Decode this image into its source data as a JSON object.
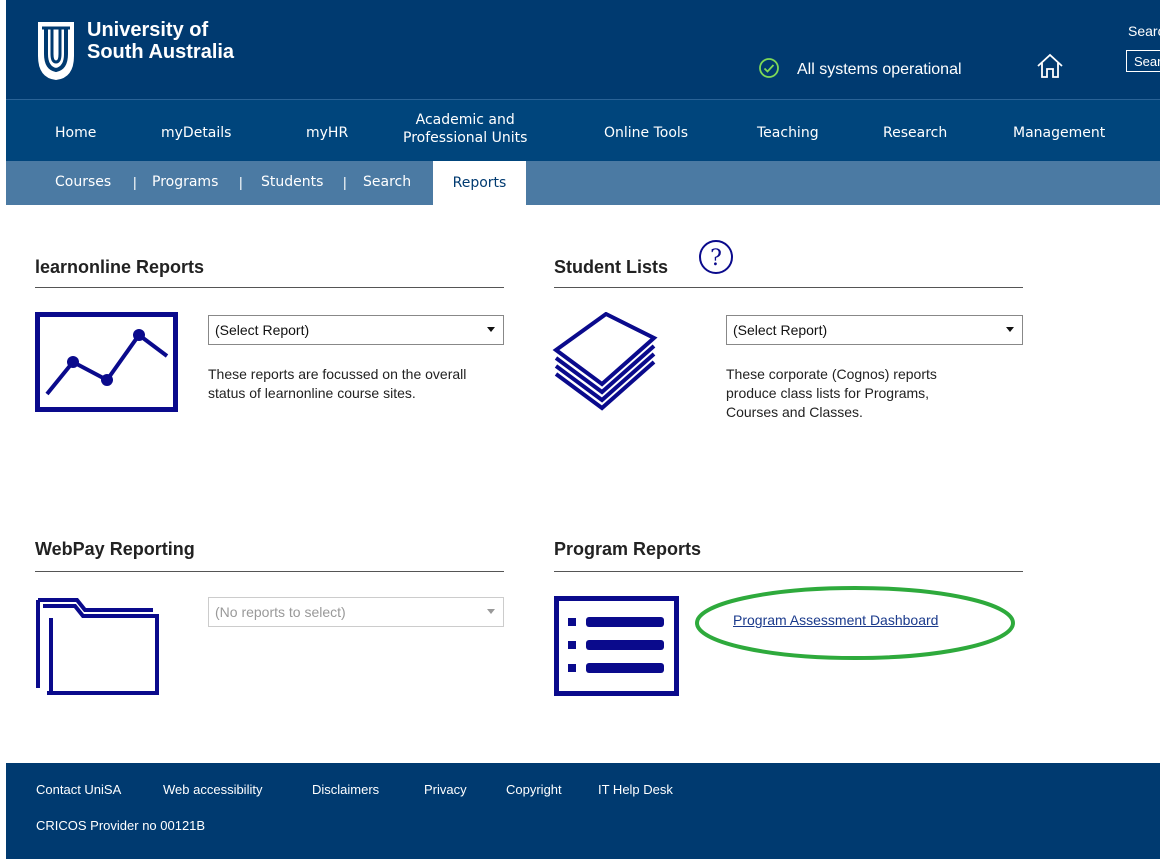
{
  "header": {
    "logo_line1": "University of",
    "logo_line2": "South Australia",
    "status_text": "All systems operational",
    "search_label": "Search",
    "search_placeholder": "Search"
  },
  "main_nav": {
    "home": "Home",
    "mydetails": "myDetails",
    "myhr": "myHR",
    "academic_line1": "Academic and",
    "academic_line2": "Professional Units",
    "online_tools": "Online Tools",
    "teaching": "Teaching",
    "research": "Research",
    "management": "Management"
  },
  "sub_nav": {
    "courses": "Courses",
    "programs": "Programs",
    "students": "Students",
    "search": "Search",
    "reports": "Reports",
    "separator": "|"
  },
  "sections": {
    "learnonline": {
      "title": "learnonline Reports",
      "select_value": "(Select Report)",
      "description_line1": "These reports are focussed on the overall",
      "description_line2": "status of learnonline course sites."
    },
    "student_lists": {
      "title": "Student Lists",
      "select_value": "(Select Report)",
      "description_line1": "These corporate (Cognos) reports",
      "description_line2": "produce class lists for Programs,",
      "description_line3": "Courses and Classes."
    },
    "webpay": {
      "title": "WebPay Reporting",
      "select_value": "(No reports to select)"
    },
    "program_reports": {
      "title": "Program Reports",
      "link": "Program Assessment Dashboard"
    }
  },
  "footer": {
    "contact": "Contact UniSA",
    "accessibility": "Web accessibility",
    "disclaimers": "Disclaimers",
    "privacy": "Privacy",
    "copyright": "Copyright",
    "helpdesk": "IT Help Desk",
    "cricos": "CRICOS Provider no 00121B"
  },
  "colors": {
    "header_bg": "#003a70",
    "nav_bg": "#00457c",
    "subnav_bg": "#4b7aa3",
    "icon_navy": "#0a0a8c",
    "status_green": "#7ed957",
    "highlight_green": "#2eaa3c"
  },
  "icons": [
    "unisa-logo-icon",
    "check-circle-icon",
    "home-icon",
    "help-icon",
    "line-chart-icon",
    "stacked-papers-icon",
    "folder-icon",
    "list-icon"
  ]
}
